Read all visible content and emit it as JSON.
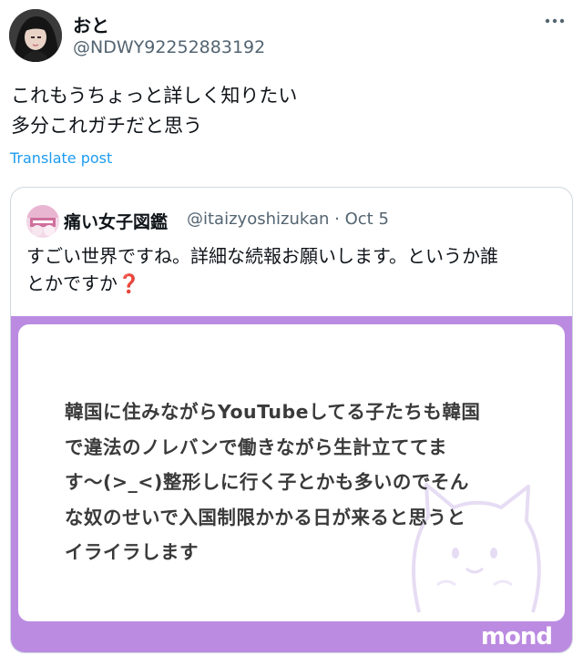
{
  "post": {
    "display_name": "おと",
    "handle": "@NDWY92252883192",
    "text_lines": [
      "これもうちょっと詳しく知りたい",
      "多分これガチだと思う"
    ],
    "translate_label": "Translate post",
    "more_icon": "more-horizontal-icon"
  },
  "quote": {
    "display_name": "痛い女子図鑑",
    "handle": "@itaizyoshizukan",
    "separator": "·",
    "date": "Oct 5",
    "text_lines": [
      "すごい世界ですね。詳細な続報お願いします。というか誰",
      "とかですか"
    ],
    "emoji": "❓",
    "image": {
      "text_lines": [
        "韓国に住みながらYouTubeしてる子たちも韓国",
        "で違法のノレバンで働きながら生計立ててま",
        "す〜(>_<)整形しに行く子とかも多いのでそん",
        "な奴のせいで入国制限かかる日が来ると思うと",
        "イライラします"
      ],
      "logo": "mond",
      "frame_color": "#bb8be2"
    }
  },
  "colors": {
    "text": "#0f1419",
    "secondary": "#536471",
    "link": "#1d9bf0",
    "border": "#cfd9de"
  }
}
